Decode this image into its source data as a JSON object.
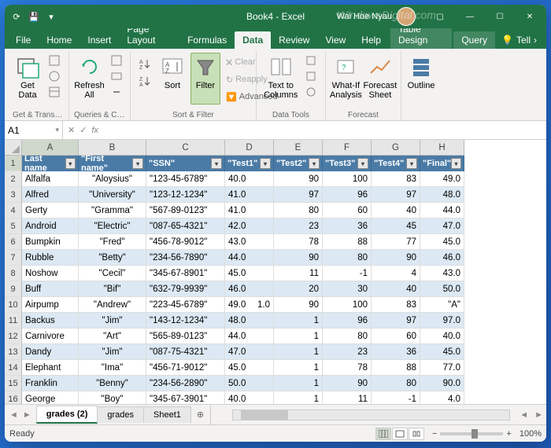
{
  "titlebar": {
    "title": "Book4 - Excel",
    "user": "Wai Hoe Nyau",
    "watermark": "WindowsDigital.com"
  },
  "tabs": {
    "file": "File",
    "home": "Home",
    "insert": "Insert",
    "pagelayout": "Page Layout",
    "formulas": "Formulas",
    "data": "Data",
    "review": "Review",
    "view": "View",
    "help": "Help",
    "tabledesign": "Table Design",
    "query": "Query",
    "tellme": "Tell"
  },
  "ribbon": {
    "getdata": "Get\nData",
    "refreshall": "Refresh\nAll",
    "sort": "Sort",
    "filter": "Filter",
    "clear": "Clear",
    "reapply": "Reapply",
    "advanced": "Advanced",
    "texttocolumns": "Text to\nColumns",
    "whatif": "What-If\nAnalysis",
    "forecast": "Forecast\nSheet",
    "outline": "Outline",
    "grp_get": "Get & Transform...",
    "grp_queries": "Queries & Co...",
    "grp_sort": "Sort & Filter",
    "grp_datatools": "Data Tools",
    "grp_forecast": "Forecast"
  },
  "fbar": {
    "namebox": "A1",
    "fx": "fx"
  },
  "columns": [
    "A",
    "B",
    "C",
    "D",
    "E",
    "F",
    "G",
    "H"
  ],
  "headers": {
    "c0": "Last name",
    "c1": "\"First name\"",
    "c2": "\"SSN\"",
    "c3": "\"Test1\"",
    "c4": "\"Test2\"",
    "c5": "\"Test3\"",
    "c6": "\"Test4\"",
    "c7": "\"Final\""
  },
  "rows": [
    {
      "n": "2",
      "c0": "Alfalfa",
      "c1": "\"Aloysius\"",
      "c2": "\"123-45-6789\"",
      "c3": "40.0",
      "c4": "90",
      "c5": "100",
      "c6": "83",
      "c7": "49.0"
    },
    {
      "n": "3",
      "c0": "Alfred",
      "c1": "\"University\"",
      "c2": "\"123-12-1234\"",
      "c3": "41.0",
      "c4": "97",
      "c5": "96",
      "c6": "97",
      "c7": "48.0"
    },
    {
      "n": "4",
      "c0": "Gerty",
      "c1": "\"Gramma\"",
      "c2": "\"567-89-0123\"",
      "c3": "41.0",
      "c4": "80",
      "c5": "60",
      "c6": "40",
      "c7": "44.0"
    },
    {
      "n": "5",
      "c0": "Android",
      "c1": "\"Electric\"",
      "c2": "\"087-65-4321\"",
      "c3": "42.0",
      "c4": "23",
      "c5": "36",
      "c6": "45",
      "c7": "47.0"
    },
    {
      "n": "6",
      "c0": "Bumpkin",
      "c1": "\"Fred\"",
      "c2": "\"456-78-9012\"",
      "c3": "43.0",
      "c4": "78",
      "c5": "88",
      "c6": "77",
      "c7": "45.0"
    },
    {
      "n": "7",
      "c0": "Rubble",
      "c1": "\"Betty\"",
      "c2": "\"234-56-7890\"",
      "c3": "44.0",
      "c4": "90",
      "c5": "80",
      "c6": "90",
      "c7": "46.0"
    },
    {
      "n": "8",
      "c0": "Noshow",
      "c1": "\"Cecil\"",
      "c2": "\"345-67-8901\"",
      "c3": "45.0",
      "c4": "11",
      "c5": "-1",
      "c6": "4",
      "c7": "43.0"
    },
    {
      "n": "9",
      "c0": "Buff",
      "c1": "\"Bif\"",
      "c2": "\"632-79-9939\"",
      "c3": "46.0",
      "c4": "20",
      "c5": "30",
      "c6": "40",
      "c7": "50.0"
    },
    {
      "n": "10",
      "c0": "Airpump",
      "c1": "\"Andrew\"",
      "c2": "\"223-45-6789\"",
      "c3": "49.0",
      "c3b": "1.0",
      "c4": "90",
      "c5": "100",
      "c6": "83",
      "c7": "\"A\""
    },
    {
      "n": "11",
      "c0": "Backus",
      "c1": "\"Jim\"",
      "c2": "\"143-12-1234\"",
      "c3": "48.0",
      "c4": "1",
      "c5": "96",
      "c6": "97",
      "c7": "97.0"
    },
    {
      "n": "12",
      "c0": "Carnivore",
      "c1": "\"Art\"",
      "c2": "\"565-89-0123\"",
      "c3": "44.0",
      "c4": "1",
      "c5": "80",
      "c6": "60",
      "c7": "40.0"
    },
    {
      "n": "13",
      "c0": "Dandy",
      "c1": "\"Jim\"",
      "c2": "\"087-75-4321\"",
      "c3": "47.0",
      "c4": "1",
      "c5": "23",
      "c6": "36",
      "c7": "45.0"
    },
    {
      "n": "14",
      "c0": "Elephant",
      "c1": "\"Ima\"",
      "c2": "\"456-71-9012\"",
      "c3": "45.0",
      "c4": "1",
      "c5": "78",
      "c6": "88",
      "c7": "77.0"
    },
    {
      "n": "15",
      "c0": "Franklin",
      "c1": "\"Benny\"",
      "c2": "\"234-56-2890\"",
      "c3": "50.0",
      "c4": "1",
      "c5": "90",
      "c6": "80",
      "c7": "90.0"
    },
    {
      "n": "16",
      "c0": "George",
      "c1": "\"Boy\"",
      "c2": "\"345-67-3901\"",
      "c3": "40.0",
      "c4": "1",
      "c5": "11",
      "c6": "-1",
      "c7": "4.0"
    }
  ],
  "sheets": {
    "s1": "grades (2)",
    "s2": "grades",
    "s3": "Sheet1"
  },
  "status": {
    "ready": "Ready",
    "zoom": "100%"
  }
}
